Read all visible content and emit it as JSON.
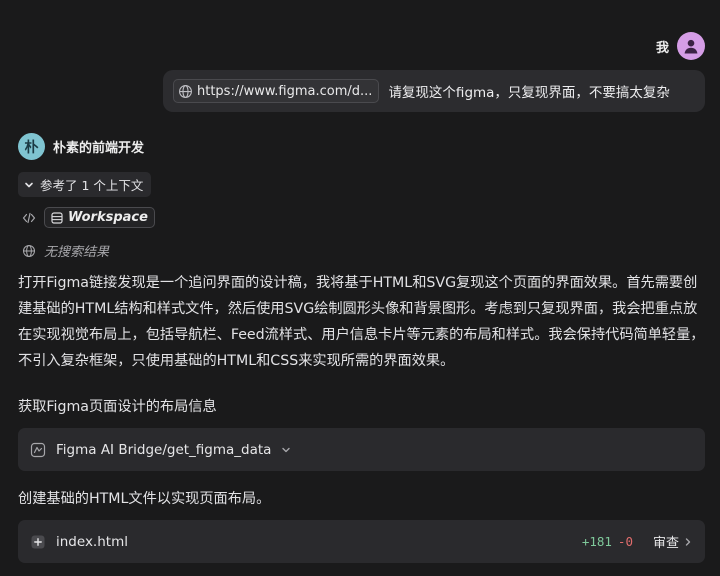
{
  "user": {
    "name": "我",
    "avatar_color": "#d59de6"
  },
  "user_message": {
    "link_text": "https://www.figma.com/d...",
    "text": "请复现这个figma，只复现界面，不要搞太复杂"
  },
  "assistant": {
    "name": "朴素的前端开发",
    "avatar_char": "朴",
    "avatar_color": "#7fc4d1"
  },
  "context_chip": {
    "label": "参考了 1 个上下文"
  },
  "workspace": {
    "label": "Workspace"
  },
  "search": {
    "label": "无搜索结果"
  },
  "paragraph": "打开Figma链接发现是一个追问界面的设计稿，我将基于HTML和SVG复现这个页面的界面效果。首先需要创建基础的HTML结构和样式文件，然后使用SVG绘制圆形头像和背景图形。考虑到只复现界面，我会把重点放在实现视觉布局上，包括导航栏、Feed流样式、用户信息卡片等元素的布局和样式。我会保持代码简单轻量，不引入复杂框架，只使用基础的HTML和CSS来实现所需的界面效果。",
  "step1": {
    "label": "获取Figma页面设计的布局信息",
    "tool_label": "Figma AI Bridge/get_figma_data"
  },
  "step2": {
    "label": "创建基础的HTML文件以实现页面布局。",
    "file_name": "index.html",
    "additions": "+181",
    "deletions": "-0",
    "review_label": "审查"
  }
}
